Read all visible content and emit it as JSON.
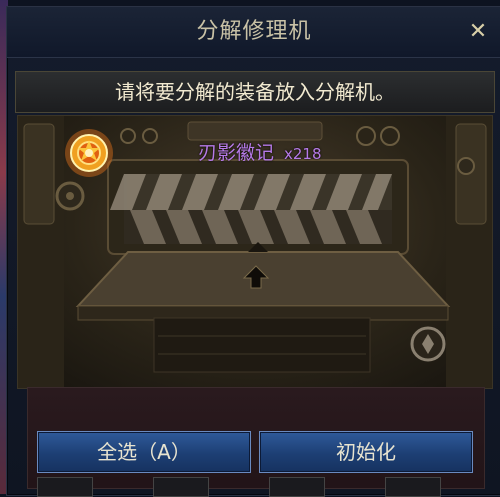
{
  "window": {
    "title": "分解修理机",
    "close_label": "✕"
  },
  "instruction": "请将要分解的装备放入分解机。",
  "machine": {
    "item_name": "刃影徽记",
    "item_count": "x218"
  },
  "buttons": {
    "select_all": "全选（A）",
    "reset": "初始化"
  },
  "colors": {
    "title_text": "#c9c2a6",
    "item_name": "#b67ae8",
    "button_blue": "#1d3f74",
    "instruction_text": "#f2ead0"
  },
  "icons": [
    "close-icon",
    "gear-emblem-icon",
    "up-arrow-icon",
    "coin-icon"
  ]
}
